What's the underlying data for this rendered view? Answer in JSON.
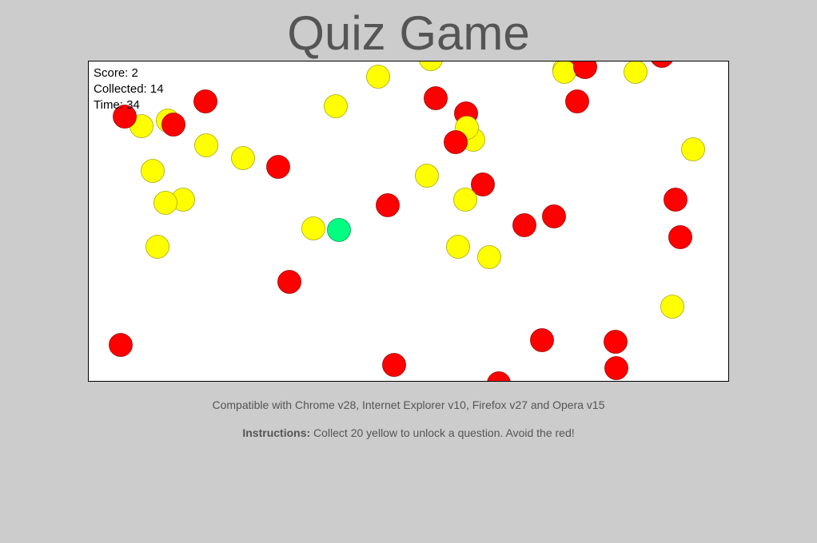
{
  "title": "Quiz Game",
  "hud": {
    "score_label": "Score: 2",
    "collected_label": "Collected: 14",
    "time_label": "Time: 34"
  },
  "compatibility": "Compatible with Chrome v28, Internet Explorer v10, Firefox v27 and Opera v15",
  "instructions": {
    "label": "Instructions:",
    "text": " Collect 20 yellow to unlock a question. Avoid the red!"
  },
  "colors": {
    "background": "#cccccc",
    "title_text": "#555555",
    "canvas_bg": "#ffffff",
    "yellow_ball": "#ffff00",
    "red_ball": "#ff0000",
    "player_ball": "#00ff80"
  }
}
